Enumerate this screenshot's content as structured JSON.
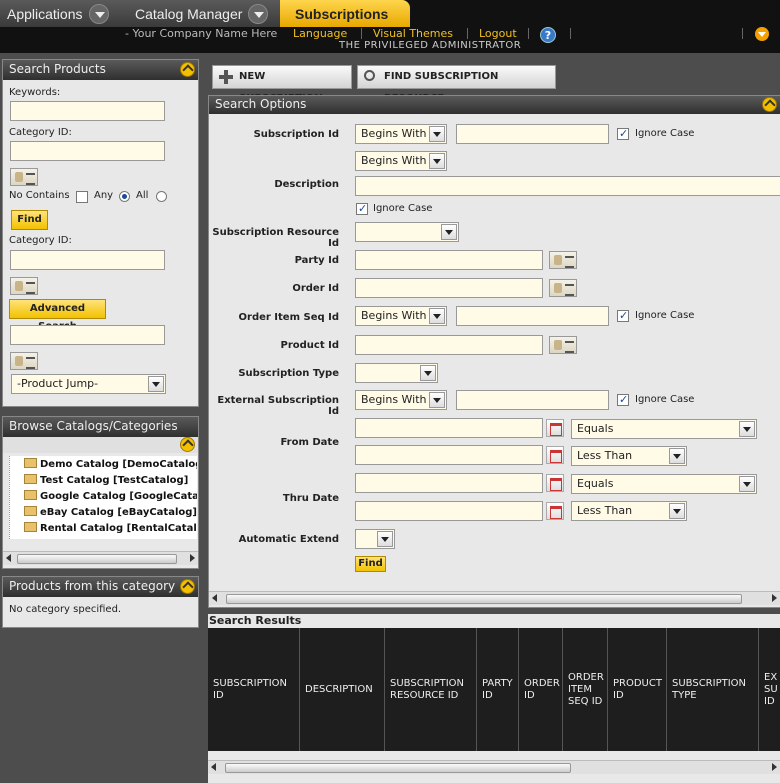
{
  "tabs": [
    {
      "label": "Applications"
    },
    {
      "label": "Catalog Manager"
    },
    {
      "label": "Subscriptions"
    }
  ],
  "header": {
    "company": "- Your Company Name Here",
    "links": [
      "Language",
      "Visual Themes",
      "Logout"
    ],
    "admin": "THE PRIVILEGED ADMINISTRATOR",
    "help": "?"
  },
  "search_products": {
    "title": "Search Products",
    "keywords_label": "Keywords:",
    "category_label": "Category ID:",
    "no_contains_label": "No Contains",
    "any_label": "Any",
    "all_label": "All",
    "find_label": "Find",
    "category2_label": "Category ID:",
    "advanced_label": "Advanced Search",
    "product_jump": "-Product Jump-"
  },
  "browse": {
    "title": "Browse Catalogs/Categories",
    "items": [
      "Demo Catalog [DemoCatalog]",
      "Test Catalog [TestCatalog]",
      "Google Catalog [GoogleCatalog",
      "eBay Catalog [eBayCatalog]",
      "Rental Catalog [RentalCatalog]"
    ]
  },
  "category_products": {
    "title": "Products from this category",
    "empty": "No category specified."
  },
  "toolbar": {
    "new_label": "NEW SUBSCRIPTION",
    "find_label": "FIND SUBSCRIPTION RESOURCE"
  },
  "search_options": {
    "title": "Search Options",
    "labels": {
      "subscription_id": "Subscription Id",
      "description": "Description",
      "resource_id": "Subscription Resource Id",
      "party_id": "Party Id",
      "order_id": "Order Id",
      "order_item_seq": "Order Item Seq Id",
      "product_id": "Product Id",
      "subscription_type": "Subscription Type",
      "external_id": "External Subscription Id",
      "from_date": "From Date",
      "thru_date": "Thru Date",
      "auto_extend": "Automatic Extend"
    },
    "begins_with": "Begins With",
    "ignore_case": "Ignore Case",
    "equals": "Equals",
    "less_than": "Less Than",
    "find_label": "Find"
  },
  "results": {
    "title": "Search Results",
    "columns": [
      "SUBSCRIPTION ID",
      "DESCRIPTION",
      "SUBSCRIPTION RESOURCE ID",
      "PARTY ID",
      "ORDER ID",
      "ORDER ITEM SEQ ID",
      "PRODUCT ID",
      "SUBSCRIPTION TYPE",
      "EX SU ID"
    ]
  },
  "icons": {
    "tab_dropdown": "chevron-down-icon",
    "help": "help-icon",
    "collapse": "collapse-up-icon",
    "lookup": "lookup-icon",
    "calendar": "calendar-icon",
    "folder": "folder-icon",
    "add": "plus-icon",
    "search": "magnifier-icon"
  },
  "colors": {
    "accent": "#f2c200",
    "header_bg": "#111111",
    "input_bg": "#fffbe6"
  }
}
